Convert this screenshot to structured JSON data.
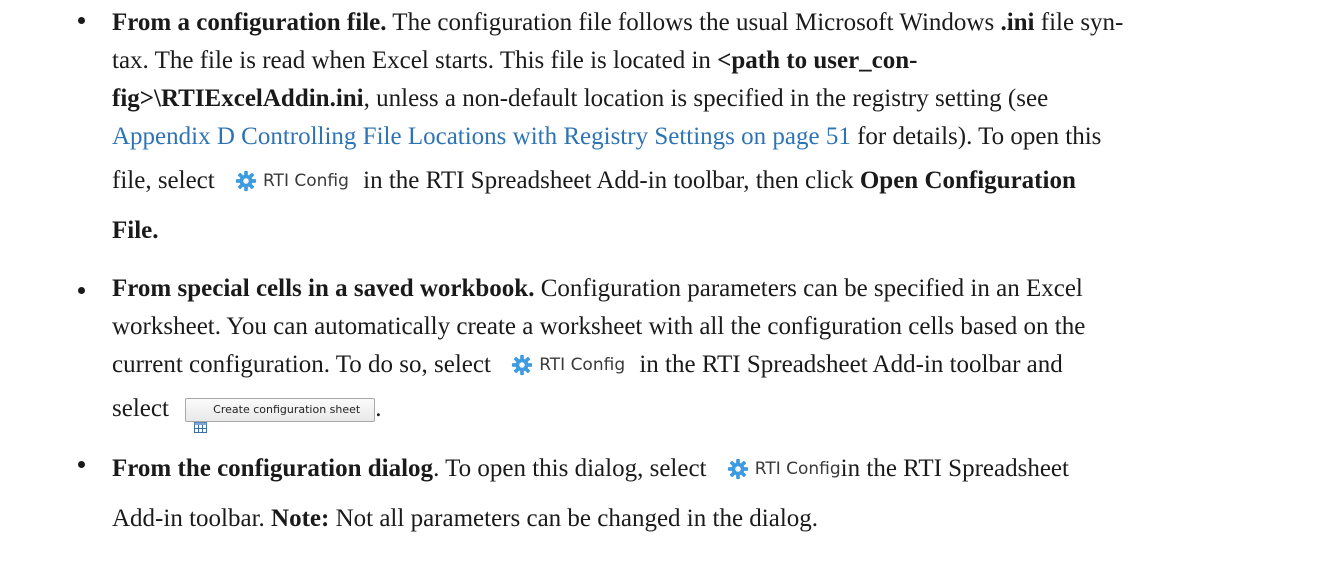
{
  "items": [
    {
      "lead": "From a configuration file.",
      "line1_rest_a": " The configuration file follows the usual Microsoft Windows ",
      "line1_bold": ".ini",
      "line1_rest_b": " file syn-",
      "line2_a": "tax. The file is read when Excel starts. This file is located in ",
      "line2_bold": "<path to user_con-",
      "line3_bold": "fig>\\RTIExcelAddin.ini",
      "line3_rest": ", unless a non-default location is specified in the registry setting (see",
      "line4_link": "Appendix D Controlling File Locations with Registry Settings on page 51",
      "line4_rest": " for details). To open this",
      "line5_a": "file, select ",
      "line5_b": " in the RTI Spreadsheet Add-in toolbar, then click ",
      "line5_bold": "Open Configuration",
      "line6_bold": "File."
    },
    {
      "lead": "From special cells in a saved workbook.",
      "line1_rest": " Configuration parameters can be specified in an Excel",
      "line2": "worksheet. You can automatically create a worksheet with all the configuration cells based on the",
      "line3_a": "current configuration. To do so, select ",
      "line3_b": " in the RTI Spreadsheet Add-in toolbar and",
      "line4_a": "select ",
      "line4_b": "."
    },
    {
      "lead": "From the configuration dialog",
      "line1_rest_a": ". To open this dialog, select ",
      "line1_rest_b": "in the RTI Spreadsheet",
      "line2_a": "Add-in toolbar. ",
      "line2_bold": "Note:",
      "line2_b": " Not all parameters can be changed in the dialog."
    }
  ],
  "rti_config_label": "RTI Config",
  "create_sheet_label": "Create configuration sheet",
  "colors": {
    "text": "#1a1a1a",
    "link": "#2e74b5",
    "gear_icon": "#3d9be0"
  }
}
